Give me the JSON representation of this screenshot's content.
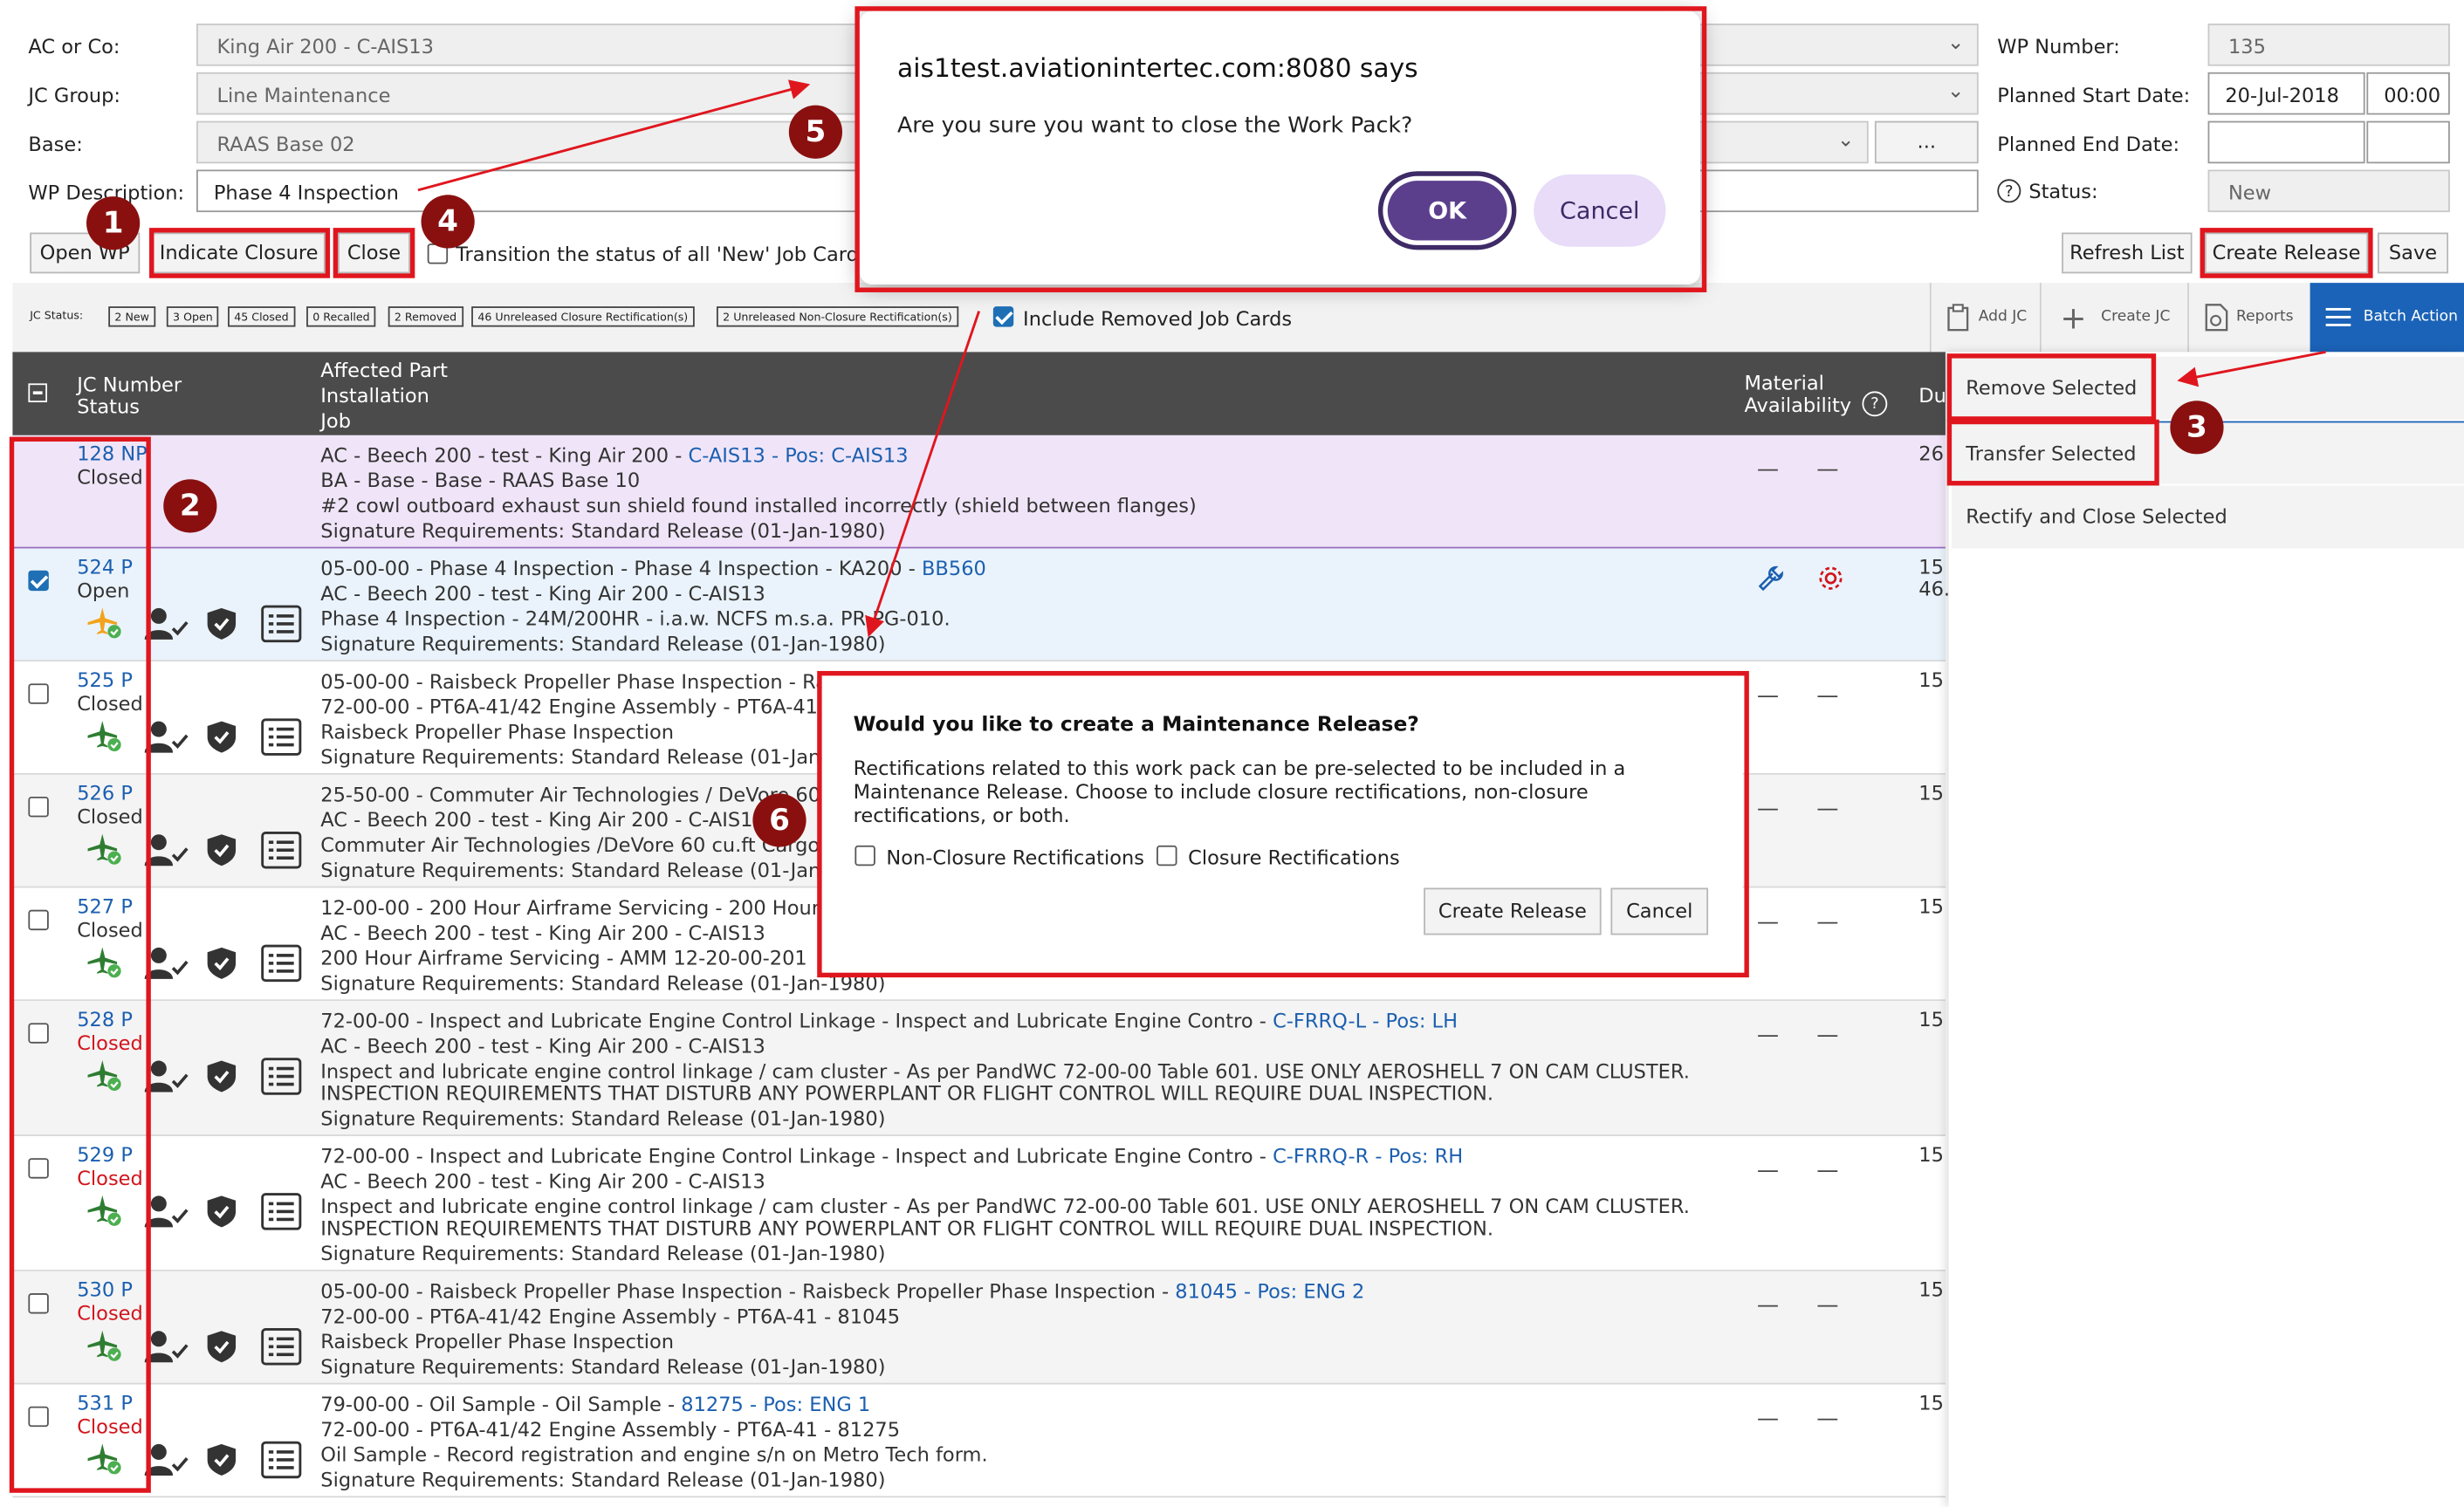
{
  "form": {
    "ac_label": "AC or Co:",
    "ac_value": "King Air 200 - C-AIS13",
    "jc_group_label": "JC Group:",
    "jc_group_value": "Line Maintenance",
    "base_label": "Base:",
    "base_value": "RAAS Base 02",
    "base_lookup": "...",
    "wp_desc_label": "WP Description:",
    "wp_desc_value": "Phase 4 Inspection",
    "wp_number_label": "WP Number:",
    "wp_number_value": "135",
    "planned_start_label": "Planned Start Date:",
    "planned_start_date": "20-Jul-2018",
    "planned_start_time": "00:00",
    "planned_end_label": "Planned End Date:",
    "status_label": "Status:",
    "status_value": "New"
  },
  "toolbar": {
    "open_wp": "Open WP",
    "indicate_closure": "Indicate Closure",
    "close": "Close",
    "transition_label": "Transition the status of all 'New' Job Cards",
    "refresh_list": "Refresh List",
    "create_release": "Create Release",
    "save": "Save"
  },
  "jc_status": {
    "label": "JC Status:",
    "badges": [
      "2 New",
      "3 Open",
      "45 Closed",
      "0 Recalled",
      "2 Removed",
      "46 Unreleased Closure Rectification(s)",
      "2 Unreleased Non-Closure Rectification(s)"
    ],
    "include_removed": "Include Removed Job Cards"
  },
  "actions": {
    "add_jc": "Add JC",
    "create_jc": "Create JC",
    "reports": "Reports",
    "batch_action": "Batch Action"
  },
  "batch_menu": [
    "Remove Selected",
    "Transfer Selected",
    "Rectify and Close Selected"
  ],
  "table_header": {
    "jc_number": "JC Number",
    "status": "Status",
    "affected_part": "Affected Part",
    "installation": "Installation",
    "job": "Job",
    "material": "Material",
    "availability": "Availability",
    "du": "Du"
  },
  "rows": [
    {
      "num": "128 NP",
      "status": "Closed",
      "l1a": "AC - Beech 200 - test - King Air 200 - ",
      "l1b": "C-AIS13 - Pos: C-AIS13",
      "l2": "BA - Base - Base - RAAS Base 10",
      "l3": "#2 cowl outboard exhaust sun shield found installed incorrectly (shield between flanges)",
      "l4": "",
      "sig": "Signature Requirements: Standard Release (01-Jan-1980)",
      "du": "26"
    },
    {
      "num": "524 P",
      "status": "Open",
      "l1a": "05-00-00 - Phase 4 Inspection - Phase 4 Inspection - KA200 - ",
      "l1b": "BB560",
      "l2": "AC - Beech 200 - test - King Air 200 - C-AIS13",
      "l3": "Phase 4 Inspection - 24M/200HR - i.a.w. NCFS m.s.a. PR-PG-010.",
      "l4": "",
      "sig": "Signature Requirements: Standard Release (01-Jan-1980)",
      "du": "15"
    },
    {
      "num": "525 P",
      "status": "Closed",
      "l1a": "05-00-00 - Raisbeck Propeller Phase Inspection - Ra",
      "l1b": "",
      "l2": "72-00-00 - PT6A-41/42 Engine Assembly - PT6A-41",
      "l3": "Raisbeck Propeller Phase Inspection",
      "l4": "",
      "sig": "Signature Requirements: Standard Release (01-Jan-",
      "du": "15"
    },
    {
      "num": "526 P",
      "status": "Closed",
      "l1a": "25-50-00 - Commuter Air Technologies / DeVore 60",
      "l1b": "",
      "l2": "AC - Beech 200 - test - King Air 200 - C-AIS13",
      "l3": "Commuter Air Technologies /DeVore 60 cu.ft Cargo P",
      "l4": "",
      "sig": "Signature Requirements: Standard Release (01-Jan-",
      "du": "15"
    },
    {
      "num": "527 P",
      "status": "Closed",
      "l1a": "12-00-00 - 200 Hour Airframe Servicing - 200 Hour",
      "l1b": "",
      "l2": "AC - Beech 200 - test - King Air 200 - C-AIS13",
      "l3": "200 Hour Airframe Servicing - AMM 12-20-00-201",
      "l4": "",
      "sig": "Signature Requirements: Standard Release (01-Jan-1980)",
      "du": "15"
    },
    {
      "num": "528 P",
      "status": "Closed",
      "l1a": "72-00-00 - Inspect and Lubricate Engine Control Linkage - Inspect and Lubricate Engine Contro - ",
      "l1b": "C-FRRQ-L - Pos: LH",
      "l2": "AC - Beech 200 - test - King Air 200 - C-AIS13",
      "l3": "Inspect and lubricate engine control linkage / cam cluster - As per PandWC 72-00-00 Table 601. USE ONLY AEROSHELL 7 ON CAM CLUSTER.",
      "l4": "INSPECTION REQUIREMENTS THAT DISTURB ANY POWERPLANT OR FLIGHT CONTROL WILL REQUIRE DUAL INSPECTION.",
      "sig": "Signature Requirements: Standard Release (01-Jan-1980)",
      "du": "15"
    },
    {
      "num": "529 P",
      "status": "Closed",
      "l1a": "72-00-00 - Inspect and Lubricate Engine Control Linkage - Inspect and Lubricate Engine Contro - ",
      "l1b": "C-FRRQ-R - Pos: RH",
      "l2": "AC - Beech 200 - test - King Air 200 - C-AIS13",
      "l3": "Inspect and lubricate engine control linkage / cam cluster - As per PandWC 72-00-00 Table 601. USE ONLY AEROSHELL 7 ON CAM CLUSTER.",
      "l4": "INSPECTION REQUIREMENTS THAT DISTURB ANY POWERPLANT OR FLIGHT CONTROL WILL REQUIRE DUAL INSPECTION.",
      "sig": "Signature Requirements: Standard Release (01-Jan-1980)",
      "du": "15"
    },
    {
      "num": "530 P",
      "status": "Closed",
      "l1a": "05-00-00 - Raisbeck Propeller Phase Inspection - Raisbeck Propeller Phase Inspection - ",
      "l1b": "81045 - Pos: ENG 2",
      "l2": "72-00-00 - PT6A-41/42 Engine Assembly - PT6A-41 - 81045",
      "l3": "Raisbeck Propeller Phase Inspection",
      "l4": "",
      "sig": "Signature Requirements: Standard Release (01-Jan-1980)",
      "du": "15"
    },
    {
      "num": "531 P",
      "status": "Closed",
      "l1a": "79-00-00 - Oil Sample - Oil Sample - ",
      "l1b": "81275 - Pos: ENG 1",
      "l2": "72-00-00 - PT6A-41/42 Engine Assembly - PT6A-41 - 81275",
      "l3": "Oil Sample - Record registration and engine s/n on Metro Tech form.",
      "l4": "",
      "sig": "Signature Requirements: Standard Release (01-Jan-1980)",
      "du": "15"
    }
  ],
  "row_extra": {
    "du_second": "46."
  },
  "confirm_dialog": {
    "title": "ais1test.aviationintertec.com:8080 says",
    "message": "Are you sure you want to close the Work Pack?",
    "ok": "OK",
    "cancel": "Cancel"
  },
  "release_dialog": {
    "title": "Would you like to create a Maintenance Release?",
    "body_1": "Rectifications related to this work pack can be pre-selected to be included in a",
    "body_2": "Maintenance Release. Choose to include closure rectifications, non-closure",
    "body_3": "rectifications, or both.",
    "non_closure": "Non-Closure Rectifications",
    "closure": "Closure Rectifications",
    "create_release": "Create Release",
    "cancel": "Cancel"
  },
  "markers": [
    "1",
    "2",
    "3",
    "4",
    "5",
    "6"
  ],
  "colors": {
    "annotation_red": "#e0161e",
    "marker_bg": "#8a1010",
    "link_blue": "#1b5fb0",
    "status_red": "#d2141c",
    "header_dark": "#4b4b4b",
    "batch_blue": "#1b63b8",
    "ok_purple": "#5b3f8c",
    "cancel_lavender": "#e8dcf8",
    "plane_green": "#2e7d32",
    "plane_orange": "#f2a31b",
    "row_purple": "#f0e5f8",
    "row_selected": "#eaf3fb"
  }
}
